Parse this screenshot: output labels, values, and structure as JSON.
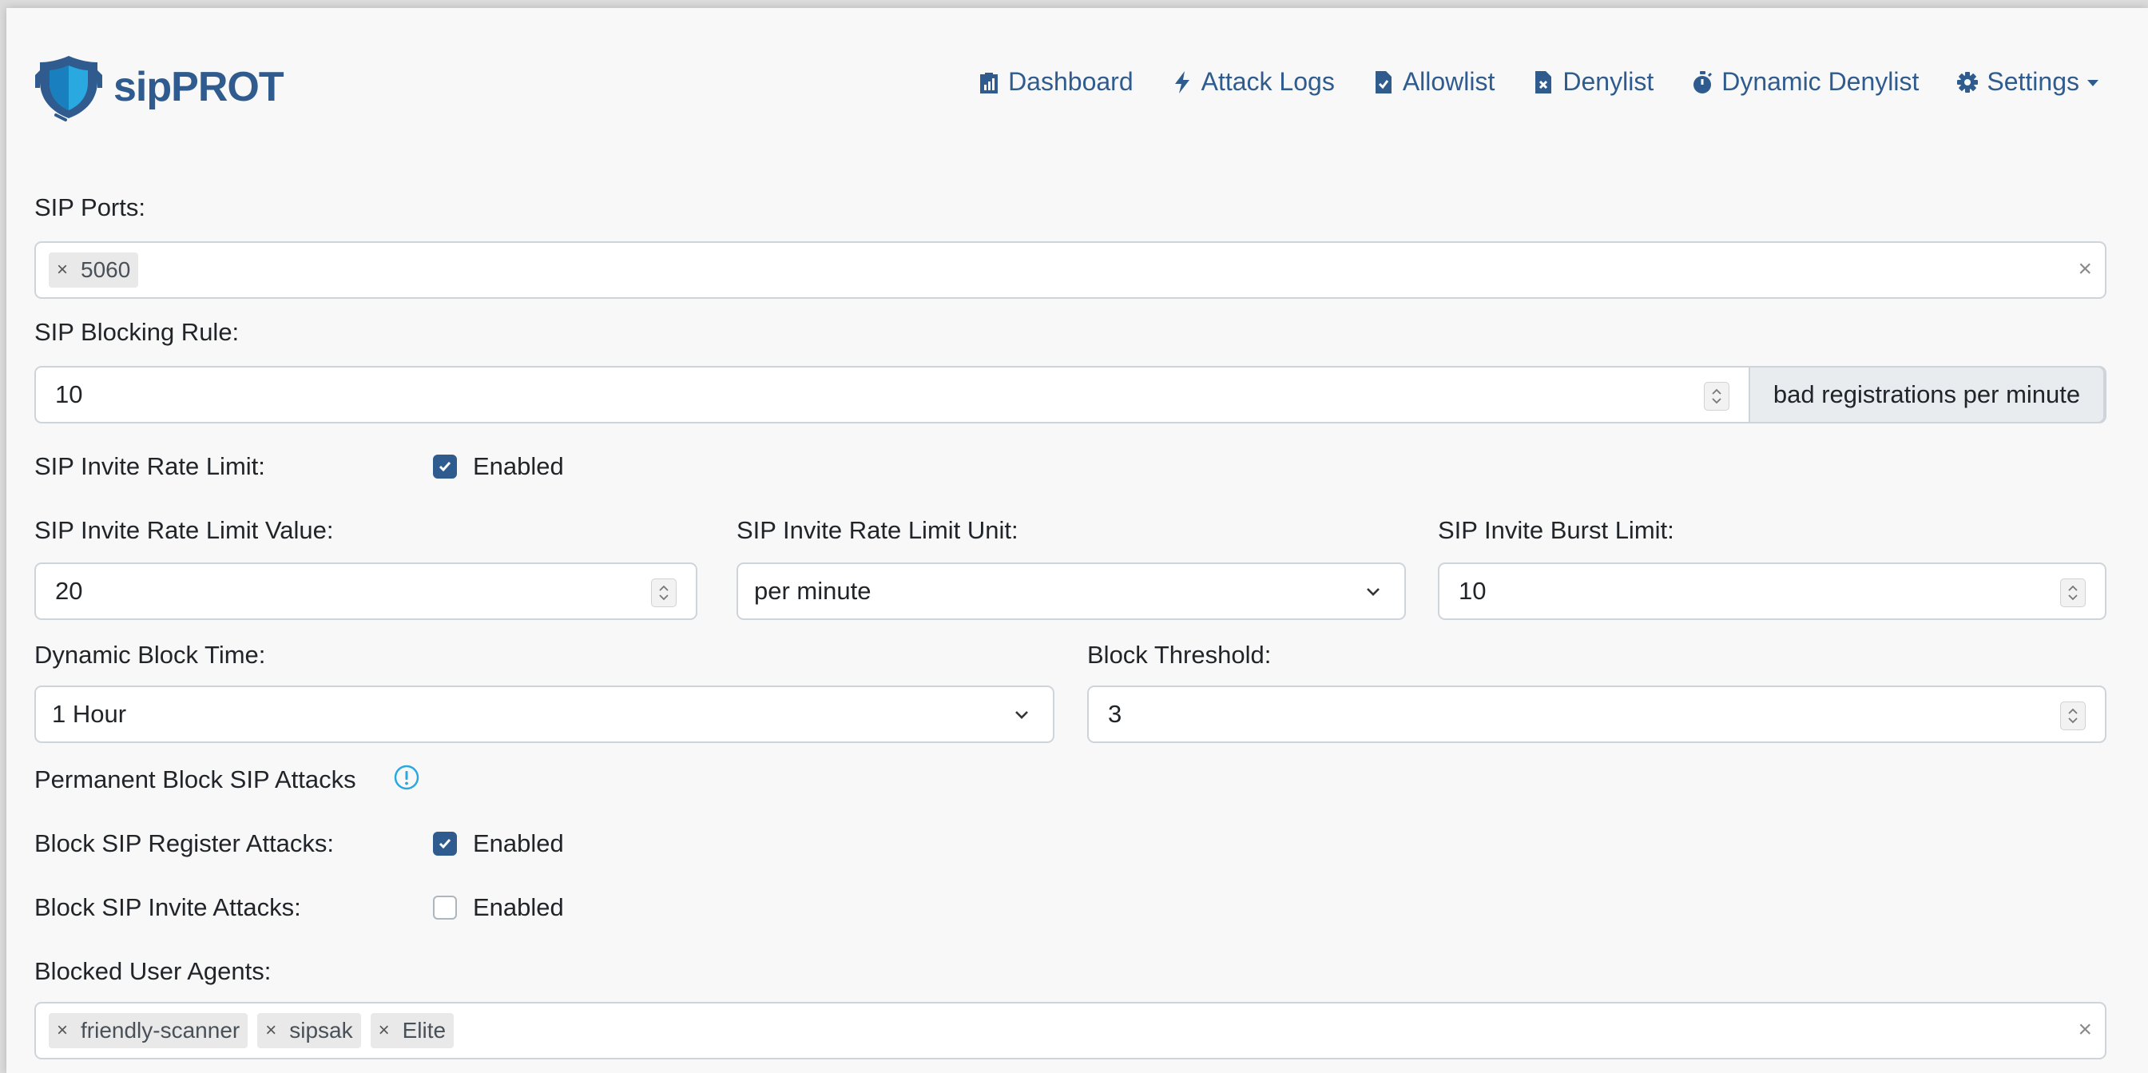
{
  "brand": {
    "name": "sipPROT"
  },
  "nav": {
    "items": [
      {
        "label": "Dashboard",
        "icon": "clipboard-chart-icon"
      },
      {
        "label": "Attack Logs",
        "icon": "bolt-icon"
      },
      {
        "label": "Allowlist",
        "icon": "file-check-icon"
      },
      {
        "label": "Denylist",
        "icon": "file-x-icon"
      },
      {
        "label": "Dynamic Denylist",
        "icon": "stopwatch-icon"
      },
      {
        "label": "Settings",
        "icon": "gear-icon"
      }
    ]
  },
  "colors": {
    "accent": "#2f5b8e",
    "info": "#2aa8e0"
  },
  "form": {
    "sip_ports": {
      "label": "SIP Ports:",
      "tags": [
        "5060"
      ]
    },
    "blocking_rule": {
      "label": "SIP Blocking Rule:",
      "value": "10",
      "addon": "bad registrations per minute"
    },
    "invite_rate_limit": {
      "label": "SIP Invite Rate Limit:",
      "checkbox_label": "Enabled",
      "checked": true
    },
    "invite_rate_value": {
      "label": "SIP Invite Rate Limit Value:",
      "value": "20"
    },
    "invite_rate_unit": {
      "label": "SIP Invite Rate Limit Unit:",
      "value": "per minute"
    },
    "invite_burst": {
      "label": "SIP Invite Burst Limit:",
      "value": "10"
    },
    "dynamic_block_time": {
      "label": "Dynamic Block Time:",
      "value": "1 Hour"
    },
    "block_threshold": {
      "label": "Block Threshold:",
      "value": "3"
    },
    "permanent_block": {
      "label": "Permanent Block SIP Attacks"
    },
    "block_register": {
      "label": "Block SIP Register Attacks:",
      "checkbox_label": "Enabled",
      "checked": true
    },
    "block_invite": {
      "label": "Block SIP Invite Attacks:",
      "checkbox_label": "Enabled",
      "checked": false
    },
    "blocked_user_agents": {
      "label": "Blocked User Agents:",
      "tags": [
        "friendly-scanner",
        "sipsak",
        "Elite"
      ]
    }
  },
  "tag_remove_glyph": "×",
  "clear_glyph": "×"
}
